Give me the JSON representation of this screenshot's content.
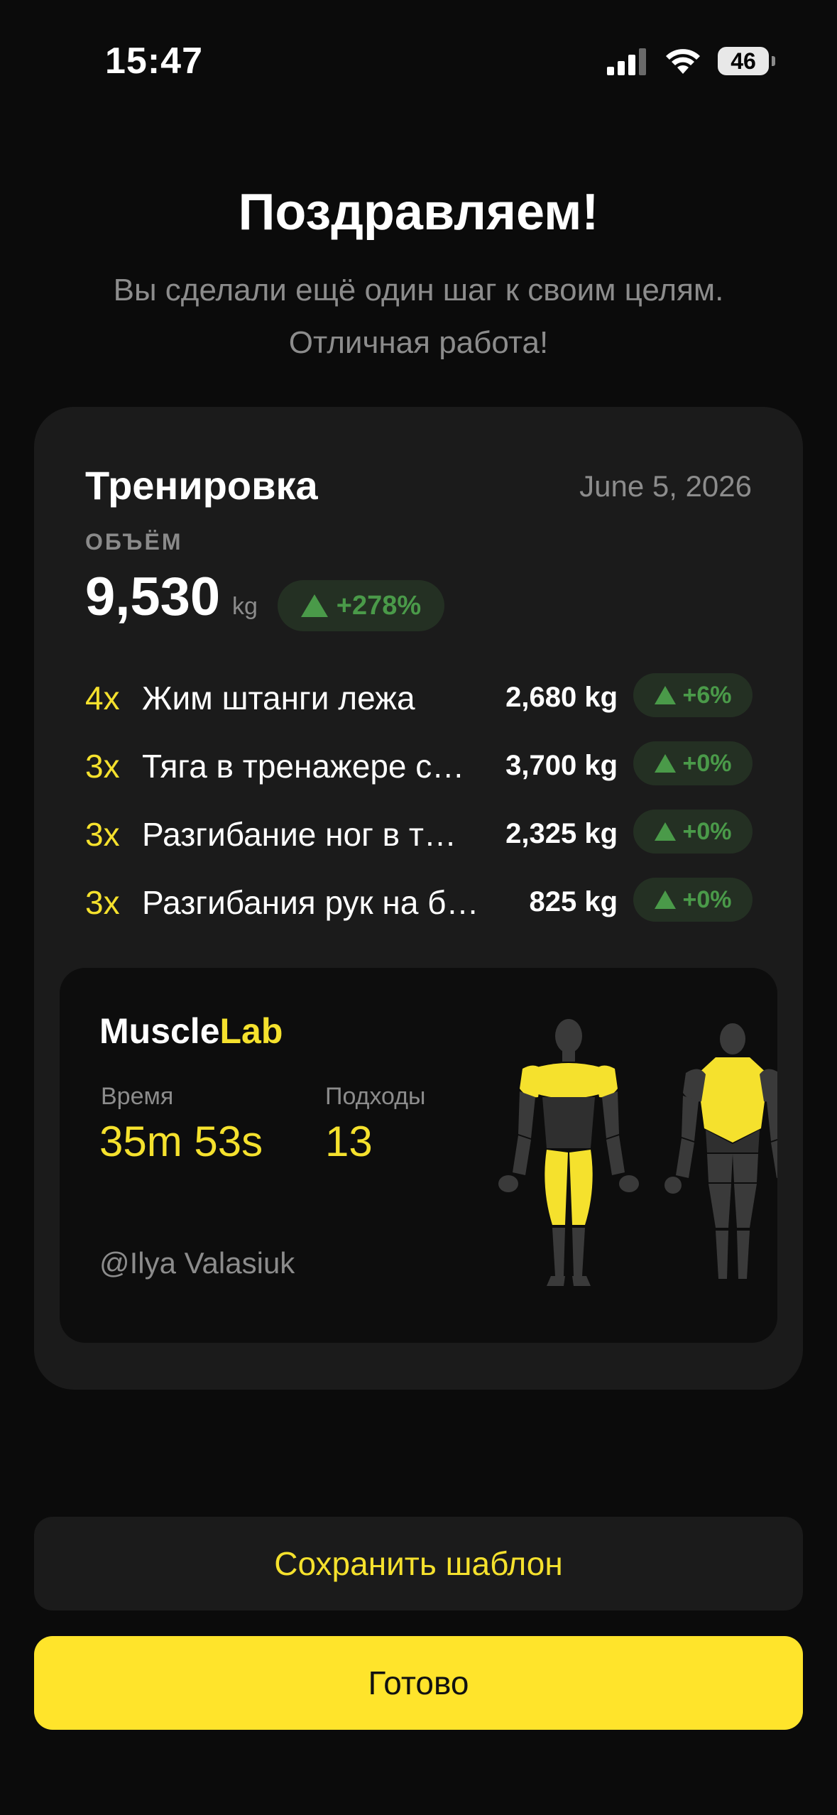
{
  "status_bar": {
    "time": "15:47",
    "battery": "46"
  },
  "header": {
    "title": "Поздравляем!",
    "subtitle": "Вы сделали ещё один шаг к своим целям. Отличная работа!"
  },
  "workout": {
    "title": "Тренировка",
    "date": "June 5, 2026",
    "volume_label": "ОБЪЁМ",
    "volume_value": "9,530",
    "volume_unit": "kg",
    "volume_change": "+278%",
    "exercises": [
      {
        "sets": "4x",
        "name": "Жим штанги лежа",
        "weight": "2,680 kg",
        "change": "+6%"
      },
      {
        "sets": "3x",
        "name": "Тяга в тренажере с…",
        "weight": "3,700 kg",
        "change": "+0%"
      },
      {
        "sets": "3x",
        "name": "Разгибание ног в т…",
        "weight": "2,325 kg",
        "change": "+0%"
      },
      {
        "sets": "3x",
        "name": "Разгибания рук на б…",
        "weight": "825 kg",
        "change": "+0%"
      }
    ]
  },
  "summary": {
    "brand_part1": "Muscle",
    "brand_part2": "Lab",
    "time_label": "Время",
    "time_value": "35m 53s",
    "sets_label": "Подходы",
    "sets_value": "13",
    "user": "@Ilya Valasiuk",
    "highlight_color": "#f5e12d"
  },
  "actions": {
    "save_template": "Сохранить шаблон",
    "done": "Готово"
  },
  "colors": {
    "accent": "#ffe42b",
    "positive": "#4a9a49",
    "card_bg": "#1b1b1b"
  }
}
